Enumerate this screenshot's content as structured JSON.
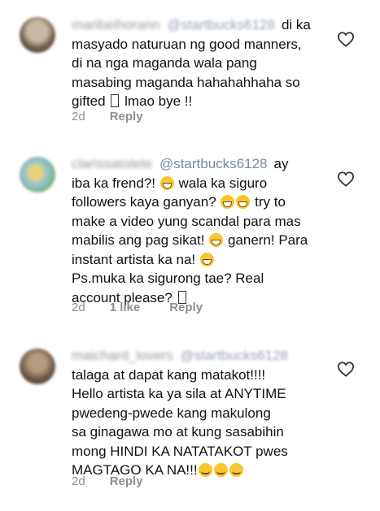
{
  "comments": [
    {
      "username": "maribelhorann",
      "mention": "@startbucks6128",
      "text_lines": [
        "di ka",
        "masyado naturuan ng good manners,",
        "di na nga maganda wala pang",
        "masabing maganda hahahahhaha so"
      ],
      "last_line": [
        "gifted",
        "",
        "lmao bye !!"
      ],
      "age": "2d",
      "likes": "",
      "reply_label": "Reply"
    },
    {
      "username": "clarissatolete",
      "mention": "@startbucks6128",
      "segments": [
        [
          "ay"
        ],
        [
          "iba ka frend?!",
          "",
          "wala ka siguro"
        ],
        [
          "followers kaya ganyan?",
          "",
          "try to"
        ],
        [
          "make a video yung scandal para mas"
        ],
        [
          "mabilis ang pag sikat!",
          "",
          "ganern! Para"
        ],
        [
          "instant artista ka na!",
          ""
        ],
        [
          "Ps.muka ka sigurong tae? Real"
        ],
        [
          "account please?",
          ""
        ]
      ],
      "age": "2d",
      "likes": "1 like",
      "reply_label": "Reply"
    },
    {
      "username": "maichard_lovers",
      "mention": "@startbucks6128",
      "text_lines": [
        "talaga at dapat kang matakot!!!!",
        "Hello artista ka ya sila at ANYTIME",
        "pwedeng-pwede kang makulong",
        "sa ginagawa mo at kung sasabihin",
        "mong HINDI KA NATATAKOT pwes",
        "MAGTAGO KA NA!!!"
      ],
      "age": "2d",
      "likes": "",
      "reply_label": "Reply"
    }
  ],
  "icons": {
    "heart": "heart-outline-icon",
    "emoji_grin": "grinning-face-icon",
    "emoji_smirk": "smirking-face-icon",
    "missing_glyph": "missing-glyph-icon"
  }
}
